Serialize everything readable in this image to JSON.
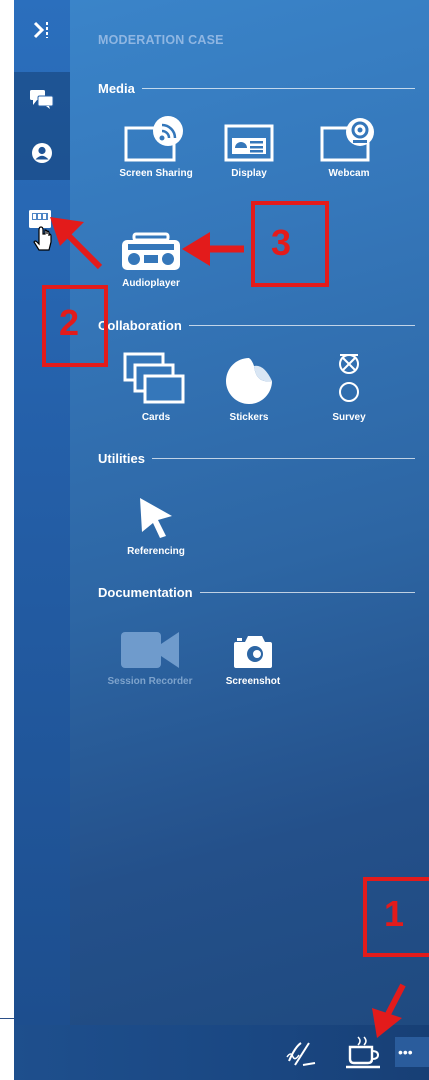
{
  "panel": {
    "title": "MODERATION CASE",
    "sections": {
      "media": {
        "heading": "Media",
        "tools": {
          "screen_sharing": "Screen Sharing",
          "display": "Display",
          "webcam": "Webcam",
          "audioplayer": "Audioplayer"
        }
      },
      "collaboration": {
        "heading": "Collaboration",
        "tools": {
          "cards": "Cards",
          "stickers": "Stickers",
          "survey": "Survey"
        }
      },
      "utilities": {
        "heading": "Utilities",
        "tools": {
          "referencing": "Referencing"
        }
      },
      "documentation": {
        "heading": "Documentation",
        "tools": {
          "session_recorder": "Session Recorder",
          "screenshot": "Screenshot"
        }
      }
    }
  },
  "leftbar": {
    "items": [
      {
        "name": "collapse-panel-button",
        "icon": "collapse-right-icon"
      },
      {
        "name": "chat-button",
        "icon": "chat-icon"
      },
      {
        "name": "participants-button",
        "icon": "user-icon"
      },
      {
        "name": "moderation-case-button",
        "icon": "toolbox-icon"
      }
    ]
  },
  "bottombar": {
    "icons": [
      "signature-icon",
      "coffee-cup-icon",
      "more-icon"
    ],
    "more_text": "•••"
  },
  "annotations": {
    "n1": "1",
    "n2": "2",
    "n3": "3"
  },
  "colors": {
    "accent_annotation": "#e31b1b",
    "panel_blue": "#3577ba",
    "bar_blue": "#1e4f8d"
  }
}
